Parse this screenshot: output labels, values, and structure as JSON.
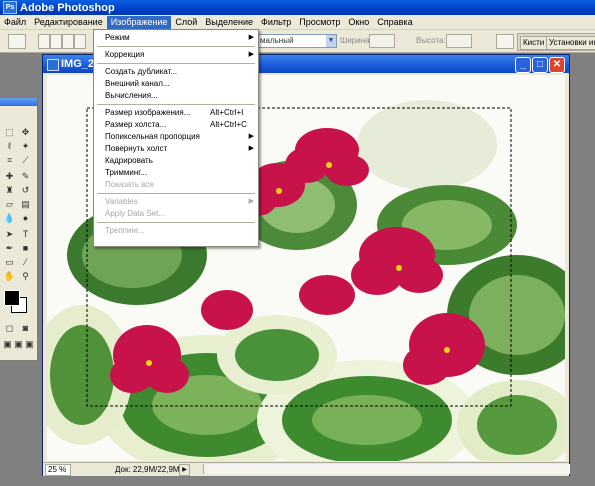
{
  "app": {
    "title": "Adobe Photoshop"
  },
  "menubar": [
    "Файл",
    "Редактирование",
    "Изображение",
    "Слой",
    "Выделение",
    "Фильтр",
    "Просмотр",
    "Окно",
    "Справка"
  ],
  "optbar": {
    "style_value": "мальный",
    "width_label": "Ширина:",
    "height_label": "Высота:"
  },
  "panel_well": {
    "tab1": "Кисти",
    "tab2": "Установки инст"
  },
  "document": {
    "title": "IMG_2",
    "zoom": "25 %",
    "doc_info": "Док: 22,9M/22,9M"
  },
  "image_menu": {
    "items": [
      {
        "label": "Режим",
        "submenu": true
      },
      {
        "separator": true
      },
      {
        "label": "Коррекция",
        "submenu": true
      },
      {
        "separator": true
      },
      {
        "label": "Создать дубликат..."
      },
      {
        "label": "Внешний канал..."
      },
      {
        "label": "Вычисления..."
      },
      {
        "separator": true
      },
      {
        "label": "Размер изображения...",
        "shortcut": "Alt+Ctrl+I"
      },
      {
        "label": "Размер холста...",
        "shortcut": "Alt+Ctrl+C"
      },
      {
        "label": "Попиксельная пропорция",
        "submenu": true
      },
      {
        "label": "Повернуть холст",
        "submenu": true
      },
      {
        "label": "Кадрировать"
      },
      {
        "label": "Тримминг..."
      },
      {
        "label": "Показать все",
        "disabled": true
      },
      {
        "separator": true
      },
      {
        "label": "Variables",
        "submenu": true,
        "disabled": true
      },
      {
        "label": "Apply Data Set...",
        "disabled": true
      },
      {
        "separator": true
      },
      {
        "label": "Треппинг...",
        "disabled": true
      }
    ]
  },
  "colors": {
    "foreground": "#000000",
    "background": "#ffffff",
    "title_blue": "#0a5fe0",
    "menu_highlight": "#316ac5",
    "flower": "#c8124a"
  }
}
